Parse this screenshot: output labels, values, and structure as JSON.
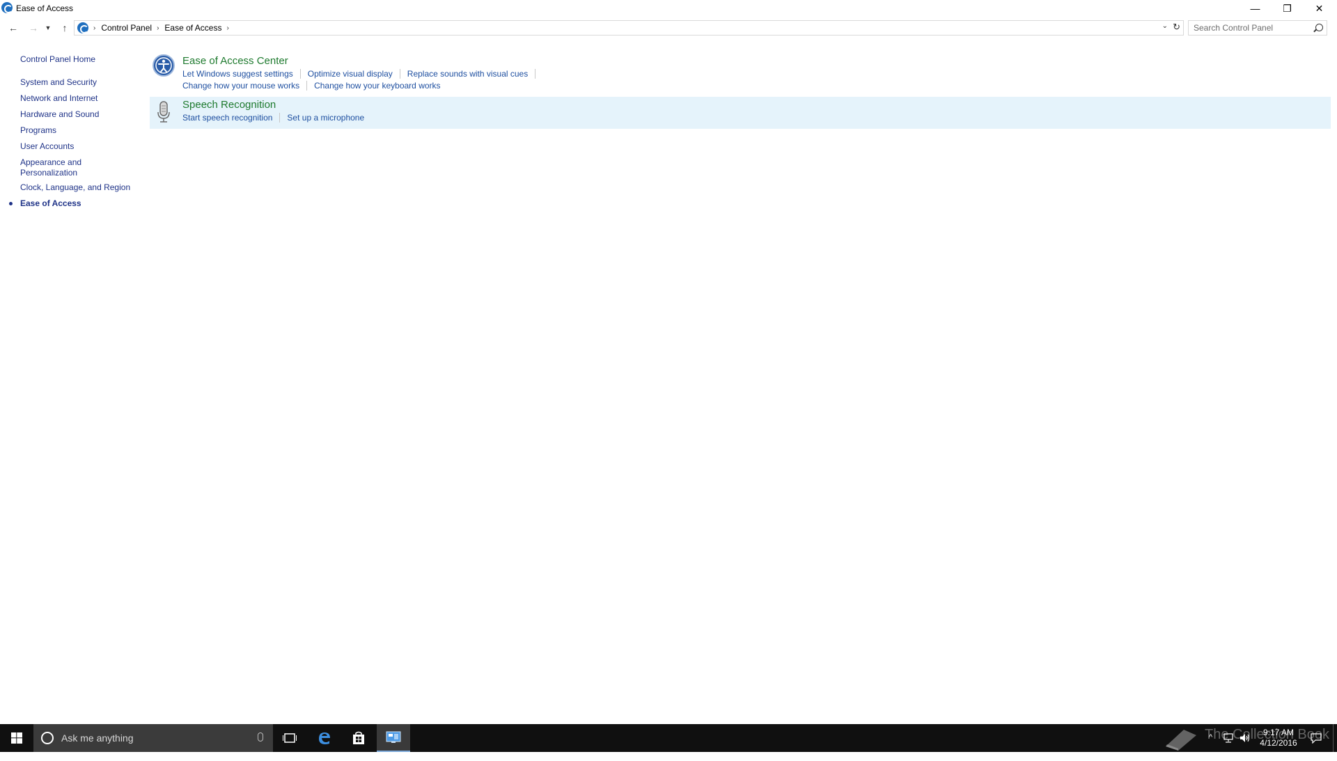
{
  "window": {
    "title": "Ease of Access",
    "minimize_glyph": "—",
    "maximize_glyph": "❐",
    "close_glyph": "✕"
  },
  "nav": {
    "back_glyph": "←",
    "forward_glyph": "→",
    "recent_glyph": "▼",
    "up_glyph": "↑",
    "breadcrumb": [
      "Control Panel",
      "Ease of Access"
    ],
    "search_placeholder": "Search Control Panel"
  },
  "sidebar": {
    "home": "Control Panel Home",
    "items": [
      "System and Security",
      "Network and Internet",
      "Hardware and Sound",
      "Programs",
      "User Accounts",
      "Appearance and",
      "Personalization",
      "Clock, Language, and Region",
      "Ease of Access"
    ]
  },
  "categories": [
    {
      "title": "Ease of Access Center",
      "links_row1": [
        "Let Windows suggest settings",
        "Optimize visual display",
        "Replace sounds with visual cues"
      ],
      "links_row2": [
        "Change how your mouse works",
        "Change how your keyboard works"
      ]
    },
    {
      "title": "Speech Recognition",
      "links_row1": [
        "Start speech recognition",
        "Set up a microphone"
      ]
    }
  ],
  "taskbar": {
    "search_placeholder": "Ask me anything",
    "time": "9:17 AM",
    "date": "4/12/2016",
    "watermark": "The Collection Book"
  },
  "colors": {
    "link_blue": "#1e4fa0",
    "category_green": "#1e7a2e",
    "hover_bg": "#e5f3fb",
    "taskbar_bg": "#101010"
  }
}
